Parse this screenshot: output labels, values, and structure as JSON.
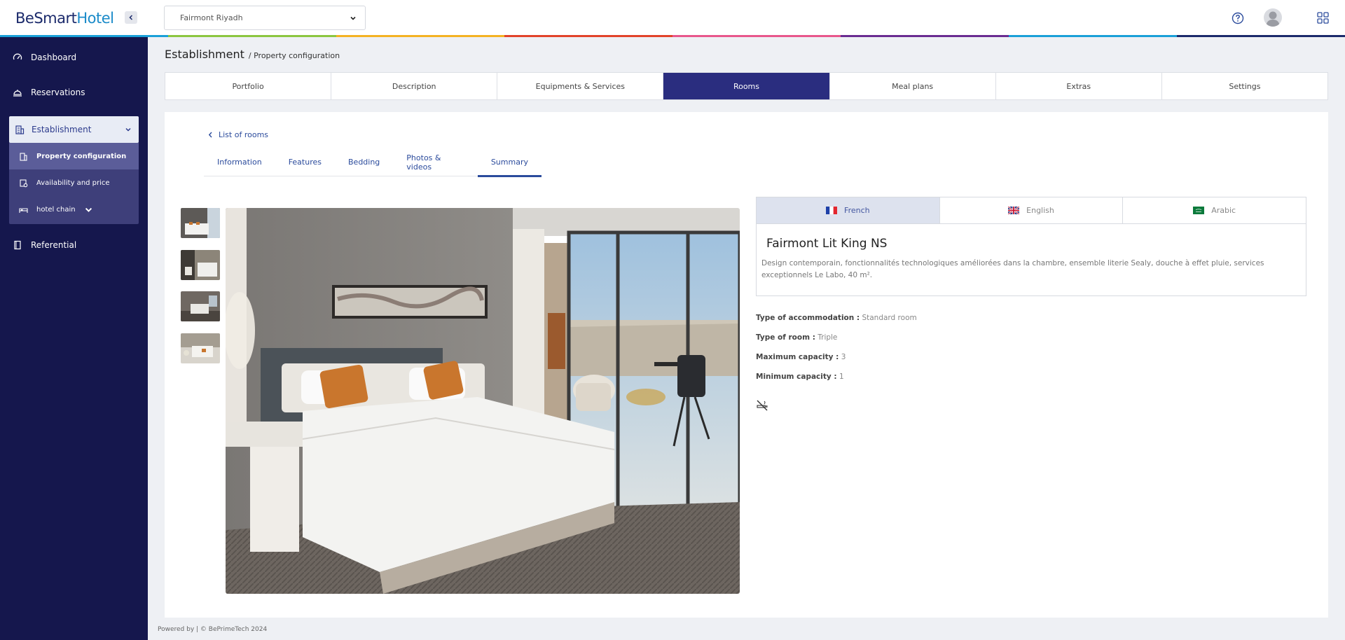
{
  "header": {
    "logo_be": "BeSmart",
    "logo_hotel": "Hotel",
    "hotel_selected": "Fairmont Riyadh",
    "rainbow_colors": [
      "#1aa0d8",
      "#8cc63f",
      "#f4b223",
      "#e2432a",
      "#e8578c",
      "#6a2c91",
      "#1aa0d8",
      "#1b2a6b"
    ]
  },
  "sidebar": {
    "dashboard": "Dashboard",
    "reservations": "Reservations",
    "establishment": "Establishment",
    "sub_items": [
      "Property configuration",
      "Availability and price",
      "hotel chain"
    ],
    "referential": "Referential"
  },
  "breadcrumb": {
    "main": "Establishment",
    "sub": "/ Property configuration"
  },
  "tabs": [
    "Portfolio",
    "Description",
    "Equipments & Services",
    "Rooms",
    "Meal plans",
    "Extras",
    "Settings"
  ],
  "room": {
    "back_label": "List of rooms",
    "subtabs": [
      "Information",
      "Features",
      "Bedding",
      "Photos & videos",
      "Summary"
    ],
    "languages": [
      "French",
      "English",
      "Arabic"
    ],
    "name": "Fairmont Lit King NS",
    "description": "Design contemporain, fonctionnalités technologiques améliorées dans la chambre, ensemble literie Sealy, douche à effet pluie, services exceptionnels Le Labo, 40 m².",
    "attributes": {
      "accommodation_label": "Type of accommodation :",
      "accommodation_value": "Standard room",
      "room_type_label": "Type of room :",
      "room_type_value": "Triple",
      "max_label": "Maximum capacity :",
      "max_value": "3",
      "min_label": "Minimum capacity :",
      "min_value": "1"
    },
    "no_smoking_icon": "no-smoking-icon"
  },
  "footer": {
    "text": "Powered by | © BePrimeTech 2024"
  },
  "colors": {
    "sidebar": "#15174d",
    "active_tab": "#2a2d7f",
    "link": "#2b4b9c"
  }
}
